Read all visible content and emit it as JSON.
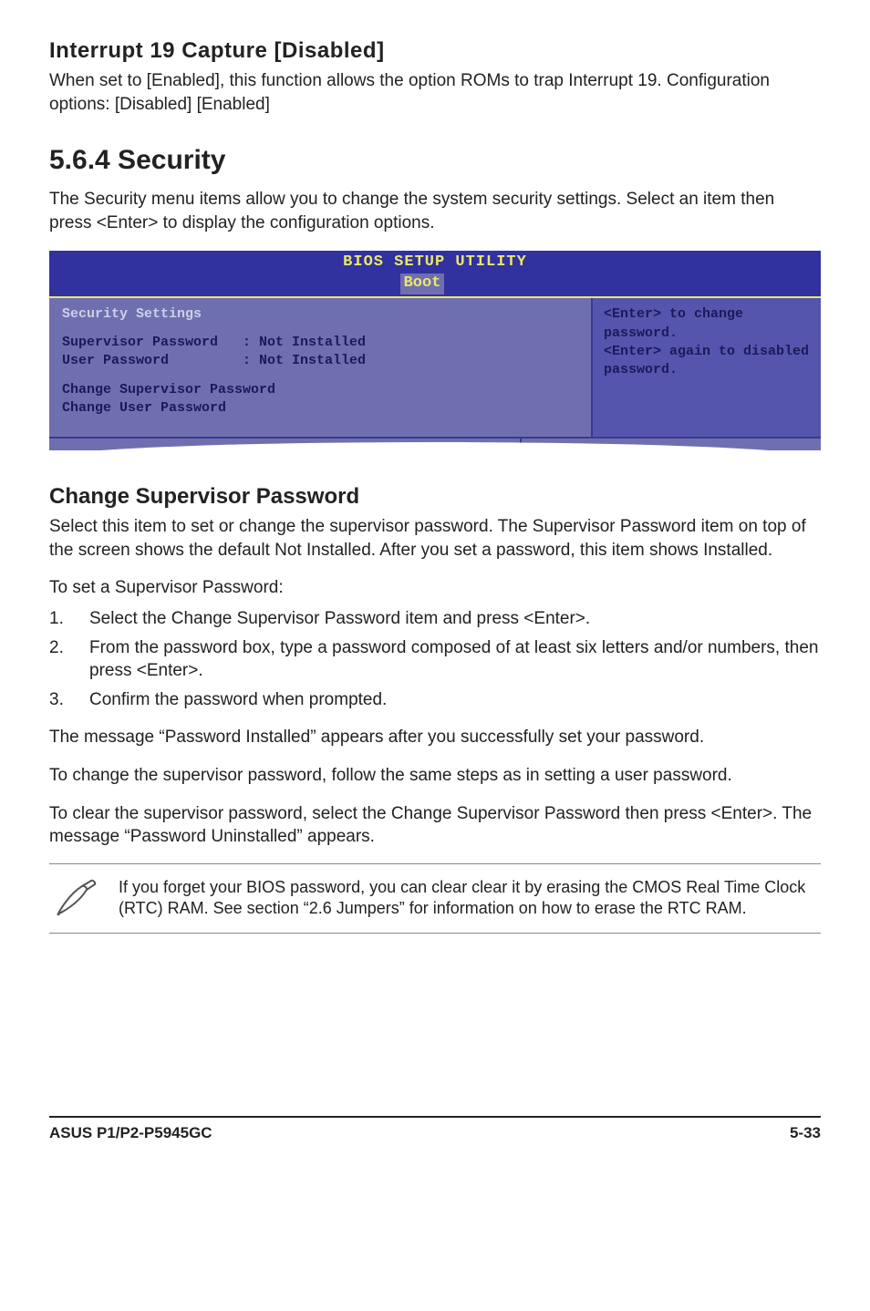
{
  "sections": {
    "int19": {
      "heading": "Interrupt 19 Capture [Disabled]",
      "text": "When set to [Enabled], this function allows the option ROMs to trap Interrupt 19. Configuration options: [Disabled] [Enabled]"
    },
    "security": {
      "heading": "5.6.4   Security",
      "intro": "The Security menu items allow you to change the system security settings. Select an item then press <Enter> to display the configuration options."
    },
    "bios": {
      "title": "BIOS SETUP UTILITY",
      "tab": "Boot",
      "left": {
        "heading": "Security Settings",
        "rows": [
          "Supervisor Password   : Not Installed",
          "User Password         : Not Installed"
        ],
        "actions": [
          "Change Supervisor Password",
          "Change User Password"
        ]
      },
      "right_help": "<Enter> to change password.\n<Enter> again to disabled password."
    },
    "csp": {
      "heading": "Change Supervisor Password",
      "p1": "Select this item to set or change the supervisor password. The Supervisor Password item on top of the screen shows the default Not Installed. After you set a password, this item shows Installed.",
      "p2": "To set a Supervisor Password:",
      "steps": [
        "Select the Change Supervisor Password item and press <Enter>.",
        "From the password box, type a password composed of at least six letters and/or numbers, then press <Enter>.",
        "Confirm the password when prompted."
      ],
      "p3": "The message “Password Installed” appears after you successfully set your password.",
      "p4": "To change the supervisor password, follow the same steps as in setting a user password.",
      "p5": "To clear the supervisor password, select the Change Supervisor Password then press <Enter>. The message “Password Uninstalled” appears."
    },
    "note": "If you forget your BIOS password, you can clear clear it by erasing the CMOS Real Time Clock (RTC) RAM. See section “2.6  Jumpers” for information on how to erase the RTC RAM."
  },
  "footer": {
    "left": "ASUS P1/P2-P5945GC",
    "right": "5-33"
  }
}
